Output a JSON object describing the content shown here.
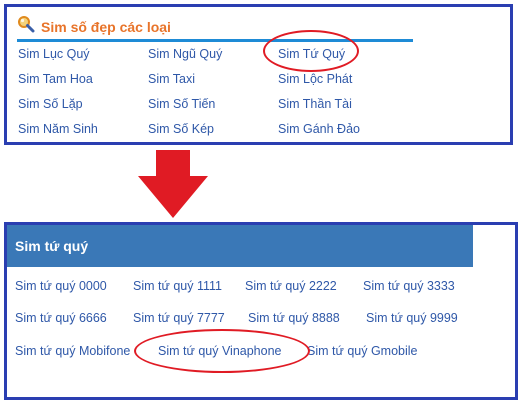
{
  "top": {
    "title": "Sim số đẹp các loại",
    "links": [
      "Sim Lục Quý",
      "Sim Ngũ Quý",
      "Sim Tứ Quý",
      "Sim Tam Hoa",
      "Sim Taxi",
      "Sim Lộc Phát",
      "Sim Số Lặp",
      "Sim Số Tiến",
      "Sim Thần Tài",
      "Sim Năm Sinh",
      "Sim Số Kép",
      "Sim Gánh Đảo"
    ]
  },
  "bottom": {
    "title": "Sim tứ quý",
    "links": [
      "Sim tứ quý 0000",
      "Sim tứ quý 1111",
      "Sim tứ quý 2222",
      "Sim tứ quý 3333",
      "Sim tứ quý 6666",
      "Sim tứ quý 7777",
      "Sim tứ quý 8888",
      "Sim tứ quý 9999",
      "Sim tứ quý Mobifone",
      "Sim tứ quý Vinaphone",
      "Sim tứ quý Gmobile"
    ]
  },
  "colors": {
    "panel_border": "#2a3eb1",
    "title_orange": "#e8742a",
    "link_blue": "#2f58a8",
    "header_blue": "#3a78b7",
    "annotation_red": "#e01b24"
  },
  "icons": {
    "search": "search-icon",
    "arrow": "arrow-down-icon"
  }
}
